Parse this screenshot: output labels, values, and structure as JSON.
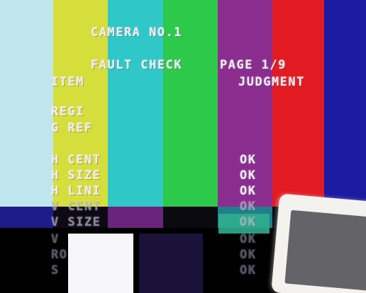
{
  "header": {
    "camera": "CAMERA NO.1",
    "mode": "FAULT CHECK",
    "page": "PAGE 1/9"
  },
  "columns": {
    "item": "ITEM",
    "judgment": "JUDGMENT"
  },
  "items": [
    {
      "label": "REGI",
      "status": ""
    },
    {
      "label": "G REF",
      "status": ""
    },
    {
      "label": "H CENT",
      "status": "OK"
    },
    {
      "label": "H SIZE",
      "status": "OK"
    },
    {
      "label": "H LINI",
      "status": "OK"
    },
    {
      "label": "V CENT",
      "status": "OK"
    },
    {
      "label": "V SIZE",
      "status": "OK"
    },
    {
      "label": "V",
      "status": "OK"
    },
    {
      "label": "RO",
      "status": "OK"
    },
    {
      "label": "S",
      "status": "OK"
    }
  ],
  "colors": {
    "bar_white": "#bfe6ec",
    "bar_yellow": "#d6de3c",
    "bar_cyan": "#2fc7c8",
    "bar_green": "#2cc94b",
    "bar_magenta": "#8a2d8f",
    "bar_red": "#e21a22",
    "bar_blue": "#1c1aa0",
    "highlight": "#2fae8d",
    "text": "#f2ecf4"
  }
}
